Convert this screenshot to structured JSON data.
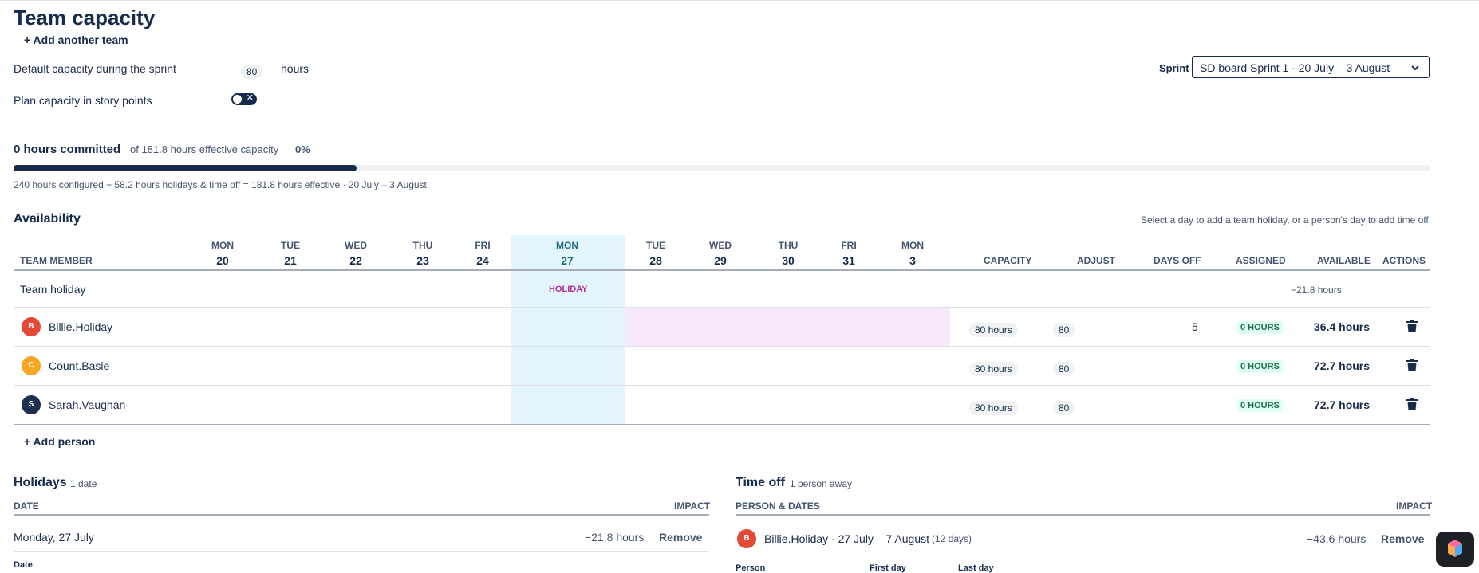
{
  "header": {
    "title": "Team capacity",
    "add_team": "+ Add another team"
  },
  "settings": {
    "default_capacity_label": "Default capacity during the sprint",
    "default_capacity_value": "80",
    "default_capacity_unit": "hours",
    "story_points_label": "Plan capacity in story points",
    "story_points_toggle": "✕",
    "sprint_label": "Sprint",
    "sprint_value": "SD board Sprint 1 · 20 July – 3 August"
  },
  "summary": {
    "committed": "0 hours committed",
    "of_capacity": "of 181.8 hours effective capacity",
    "percent": "0%",
    "progress_fraction": 0.242,
    "breakdown": "240 hours configured − 58.2 hours holidays & time off = 181.8 hours effective · 20 July – 3 August"
  },
  "availability": {
    "title": "Availability",
    "hint": "Select a day to add a team holiday, or a person's day to add time off.",
    "member_header": "TEAM MEMBER",
    "days": [
      {
        "dow": "MON",
        "d": "20"
      },
      {
        "dow": "TUE",
        "d": "21"
      },
      {
        "dow": "WED",
        "d": "22"
      },
      {
        "dow": "THU",
        "d": "23"
      },
      {
        "dow": "FRI",
        "d": "24"
      },
      {
        "dow": "MON",
        "d": "27"
      },
      {
        "dow": "TUE",
        "d": "28"
      },
      {
        "dow": "WED",
        "d": "29"
      },
      {
        "dow": "THU",
        "d": "30"
      },
      {
        "dow": "FRI",
        "d": "31"
      },
      {
        "dow": "MON",
        "d": "3"
      }
    ],
    "cols": {
      "capacity": "CAPACITY",
      "adjust": "ADJUST",
      "days_off": "DAYS OFF",
      "assigned": "ASSIGNED",
      "available": "AVAILABLE",
      "actions": "ACTIONS"
    },
    "team_holiday": {
      "label": "Team holiday",
      "marker": "HOLIDAY",
      "impact": "−21.8 hours"
    },
    "members": [
      {
        "initial": "B",
        "name": "Billie.Holiday",
        "capacity": "80 hours",
        "adjust": "80",
        "days_off": "5",
        "assigned": "0 HOURS",
        "available": "36.4 hours"
      },
      {
        "initial": "C",
        "name": "Count.Basie",
        "capacity": "80 hours",
        "adjust": "80",
        "days_off": "—",
        "assigned": "0 HOURS",
        "available": "72.7 hours"
      },
      {
        "initial": "S",
        "name": "Sarah.Vaughan",
        "capacity": "80 hours",
        "adjust": "80",
        "days_off": "—",
        "assigned": "0 HOURS",
        "available": "72.7 hours"
      }
    ],
    "add_person": "+ Add person"
  },
  "holidays": {
    "title": "Holidays",
    "count": "1 date",
    "col_date": "DATE",
    "col_impact": "IMPACT",
    "rows": [
      {
        "date": "Monday, 27 July",
        "impact": "−21.8 hours",
        "remove": "Remove"
      }
    ],
    "form_date_label": "Date"
  },
  "timeoff": {
    "title": "Time off",
    "count": "1 person away",
    "col_person": "PERSON & DATES",
    "col_impact": "IMPACT",
    "rows": [
      {
        "initial": "B",
        "text": "Billie.Holiday · 27 July – 7 August",
        "days": "(12 days)",
        "impact": "−43.6 hours",
        "remove": "Remove"
      }
    ],
    "form_person": "Person",
    "form_first": "First day",
    "form_last": "Last day"
  },
  "colors": {
    "primary": "#172b4d",
    "holiday_col": "#e3f6fc",
    "timeoff_band": "#f8e8fb",
    "holiday_text": "#ae2e9d",
    "avatar_b": "#e34935",
    "avatar_c": "#f5a623",
    "avatar_s": "#1e2f4f"
  }
}
